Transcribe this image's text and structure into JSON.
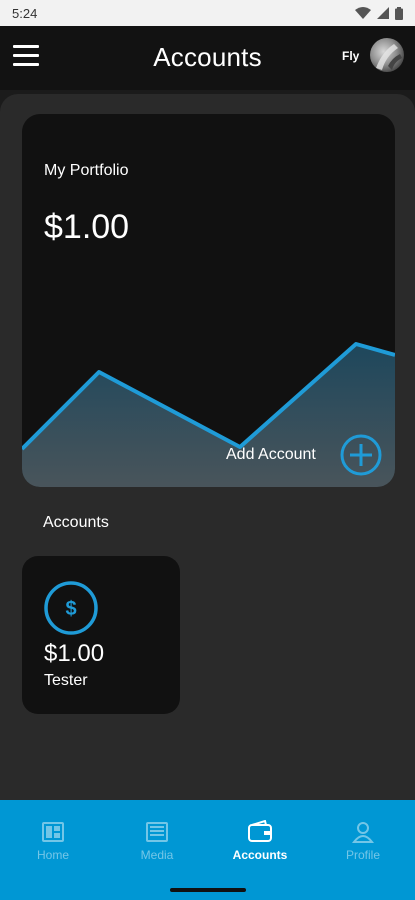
{
  "status_bar": {
    "time": "5:24",
    "icons": [
      "wifi-icon",
      "signal-icon",
      "battery-icon"
    ]
  },
  "header": {
    "title": "Accounts",
    "user_name": "Fly",
    "menu_icon": "hamburger-menu-icon",
    "avatar_icon": "avatar"
  },
  "portfolio": {
    "label": "My Portfolio",
    "value": "$1.00",
    "add_account_label": "Add Account",
    "add_icon": "plus-circle-icon",
    "chart_color": "#1f9bd7"
  },
  "accounts_section": {
    "heading": "Accounts",
    "items": [
      {
        "value": "$1.00",
        "name": "Tester",
        "icon": "dollar-circle-icon"
      }
    ]
  },
  "bottom_nav": {
    "background": "#0097d4",
    "items": [
      {
        "label": "Home",
        "icon": "home-icon",
        "active": false
      },
      {
        "label": "Media",
        "icon": "media-icon",
        "active": false
      },
      {
        "label": "Accounts",
        "icon": "wallet-icon",
        "active": true
      },
      {
        "label": "Profile",
        "icon": "profile-icon",
        "active": false
      }
    ]
  }
}
